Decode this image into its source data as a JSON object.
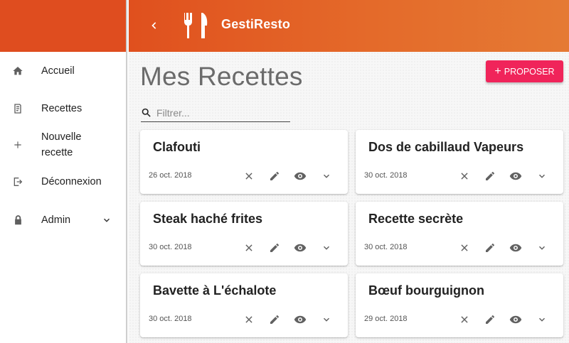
{
  "header": {
    "title": "GestiResto"
  },
  "sidebar": {
    "items": [
      {
        "label": "Accueil",
        "icon": "home-icon"
      },
      {
        "label": "Recettes",
        "icon": "receipt-icon"
      },
      {
        "label": "Nouvelle recette",
        "icon": "plus-icon"
      },
      {
        "label": "Déconnexion",
        "icon": "logout-icon"
      },
      {
        "label": "Admin",
        "icon": "lock-icon"
      }
    ]
  },
  "main": {
    "title": "Mes Recettes",
    "propose_label": "PROPOSER",
    "filter_placeholder": "Filtrer..."
  },
  "recipes": [
    {
      "name": "Clafouti",
      "date": "26 oct. 2018"
    },
    {
      "name": "Dos de cabillaud Vapeurs",
      "date": "30 oct. 2018"
    },
    {
      "name": "Steak haché frites",
      "date": "30 oct. 2018"
    },
    {
      "name": "Recette secrète",
      "date": "30 oct. 2018"
    },
    {
      "name": "Bavette à L'échalote",
      "date": "30 oct. 2018"
    },
    {
      "name": "Bœuf bourguignon",
      "date": "29 oct. 2018"
    }
  ],
  "colors": {
    "primary": "#df4d1f",
    "accent": "#f0245a"
  }
}
